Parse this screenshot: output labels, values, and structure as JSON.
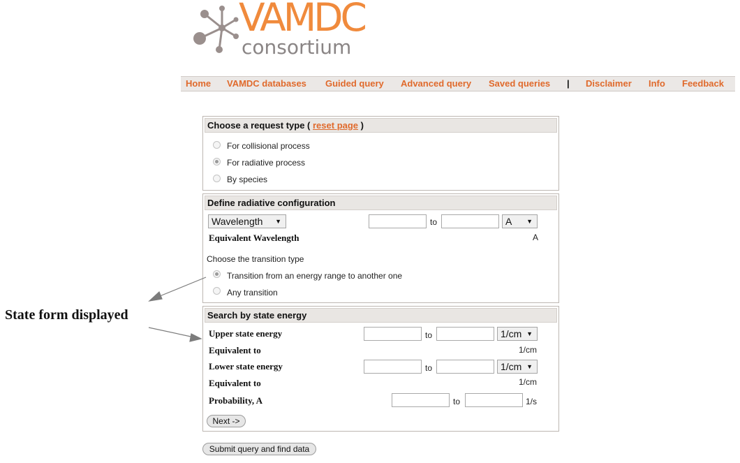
{
  "logo": {
    "title": "VAMDC",
    "subtitle": "consortium"
  },
  "nav": {
    "items": [
      "Home",
      "VAMDC databases",
      "Guided query",
      "Advanced query",
      "Saved queries"
    ],
    "separator": "|",
    "right_items": [
      "Disclaimer",
      "Info",
      "Feedback"
    ]
  },
  "request_type": {
    "heading_prefix": "Choose a request type (",
    "reset_link": "reset page",
    "heading_suffix": ")",
    "options": [
      {
        "label": "For collisional process",
        "checked": false
      },
      {
        "label": "For radiative process",
        "checked": true
      },
      {
        "label": "By species",
        "checked": false
      }
    ]
  },
  "radiative": {
    "heading": "Define radiative configuration",
    "quantity_select": "Wavelength",
    "to_label": "to",
    "unit_select": "A",
    "equivalent_label": "Equivalent Wavelength",
    "equivalent_unit": "A",
    "transition_prompt": "Choose the transition type",
    "transition_options": [
      {
        "label": "Transition from an energy range to another one",
        "checked": true
      },
      {
        "label": "Any transition",
        "checked": false
      }
    ]
  },
  "state_energy": {
    "heading": "Search by state energy",
    "upper_label": "Upper state energy",
    "upper_to": "to",
    "upper_unit": "1/cm",
    "upper_equiv_label": "Equivalent to",
    "upper_equiv_unit": "1/cm",
    "lower_label": "Lower state energy",
    "lower_to": "to",
    "lower_unit": "1/cm",
    "lower_equiv_label": "Equivalent to",
    "lower_equiv_unit": "1/cm",
    "prob_label": "Probability, A",
    "prob_to": "to",
    "prob_unit": "1/s",
    "next_button": "Next ->"
  },
  "submit_button": "Submit query and find data",
  "annotation": "State form displayed"
}
